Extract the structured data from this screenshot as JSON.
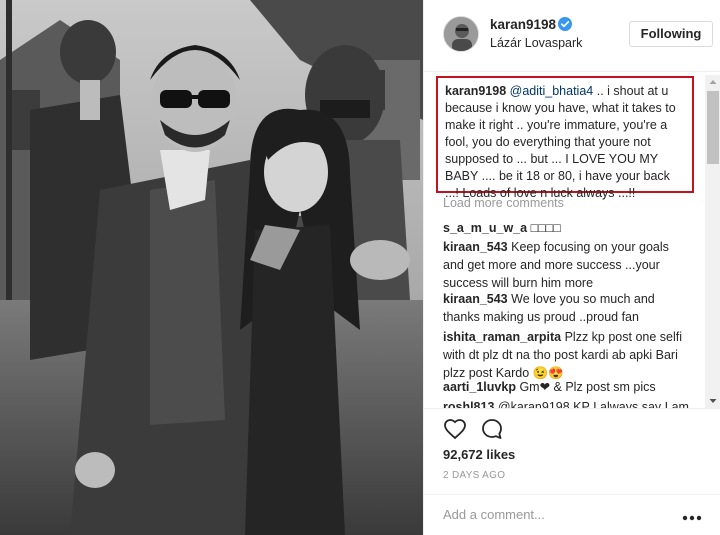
{
  "post": {
    "username": "karan9198",
    "location": "Lázár Lovaspark",
    "follow_label": "Following"
  },
  "caption": {
    "username": "karan9198",
    "mention": "@aditi_bhatia4",
    "text": ".. i shout at u because i know you have, what it takes to make it right .. you're immature, you're a fool, you do everything that youre not supposed to ... but ... I LOVE YOU MY BABY .... be it 18 or 80, i have your back ...! Loads of love n luck always ...!!"
  },
  "load_more_label": "Load more comments",
  "comments": [
    {
      "user": "s_a_m_u_w_a",
      "text": "□□□□"
    },
    {
      "user": "kiraan_543",
      "text": "Keep focusing on your goals and get more and more success ...your success will burn him more"
    },
    {
      "user": "kiraan_543",
      "text": "We love you so much and thanks making us proud ..proud fan"
    },
    {
      "user": "ishita_raman_arpita",
      "text": "Plzz kp post one selfi with dt plz dt na tho post kardi ab apki Bari plzz post Kardo 😉😍"
    },
    {
      "user": "aarti_1luvkp",
      "text": "Gm❤ & Plz post sm pics"
    },
    {
      "user": "roshl813",
      "text": "@karan9198 KP I always say I am"
    }
  ],
  "likes": "92,672 likes",
  "time": "2 DAYS AGO",
  "add_comment_placeholder": "Add a comment...",
  "icons": {
    "verified": "verified-badge-icon",
    "like": "heart-outline-icon",
    "comment": "speech-bubble-icon",
    "more": "more-options-icon"
  },
  "colors": {
    "highlight_border": "#c1121f",
    "verified": "#3897f0",
    "mention": "#003569",
    "muted": "#999999"
  }
}
